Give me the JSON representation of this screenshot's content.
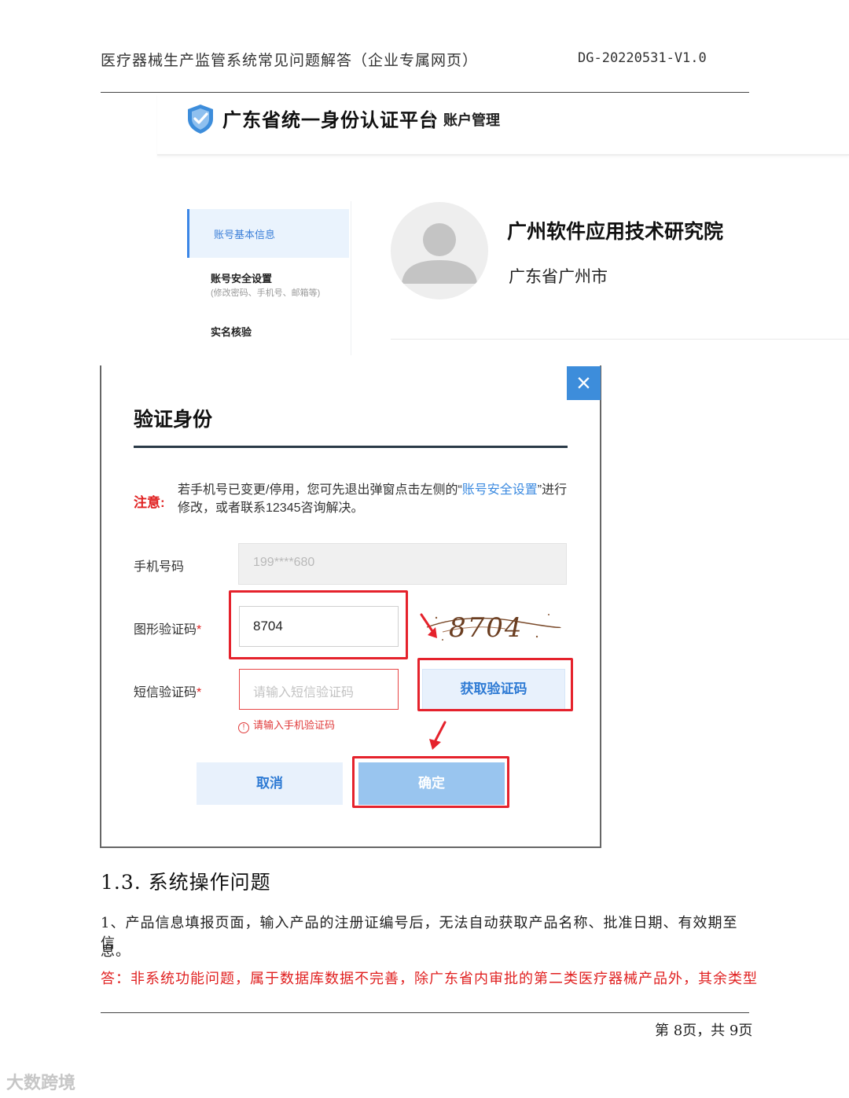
{
  "header": {
    "title": "医疗器械生产监管系统常见问题解答（企业专属网页）",
    "doc_id": "DG-20220531-V1.0"
  },
  "platform": {
    "title": "广东省统一身份认证平台",
    "subtitle": "账户管理"
  },
  "sidebar": {
    "items": [
      {
        "label": "账号基本信息"
      },
      {
        "label": "账号安全设置",
        "sub": "(修改密码、手机号、邮箱等)"
      },
      {
        "label": "实名核验"
      }
    ]
  },
  "profile": {
    "name": "广州软件应用技术研究院",
    "location": "广东省广州市"
  },
  "dialog": {
    "close_icon": "×",
    "title": "验证身份",
    "note_label": "注意:",
    "note_text_1": "若手机号已变更/停用，您可先退出弹窗点击左侧的“",
    "note_link": "账号安全设置",
    "note_text_2": "”进行修改，或者联系12345咨询解决。",
    "phone_label": "手机号码",
    "phone_value": "199****680",
    "captcha_label": "图形验证码",
    "required_mark": "*",
    "captcha_value": "8704",
    "captcha_image_text": "8704",
    "sms_label": "短信验证码",
    "sms_placeholder": "请输入短信验证码",
    "get_code_label": "获取验证码",
    "error_icon": "!",
    "error_text": "请输入手机验证码",
    "cancel_label": "取消",
    "ok_label": "确定"
  },
  "section": {
    "title": "1.3.  系统操作问题",
    "q1_line1": "1、产品信息填报页面，输入产品的注册证编号后，无法自动获取产品名称、批准日期、有效期至信",
    "q1_line2": "息。",
    "answer": "答：非系统功能问题，属于数据库数据不完善，除广东省内审批的第二类医疗器械产品外，其余类型"
  },
  "footer": {
    "page": "第 8页，共 9页"
  },
  "watermark": "大数跨境",
  "colors": {
    "accent_blue": "#3d8ddb",
    "highlight_red": "#e5222c",
    "answer_red": "#e02020"
  }
}
